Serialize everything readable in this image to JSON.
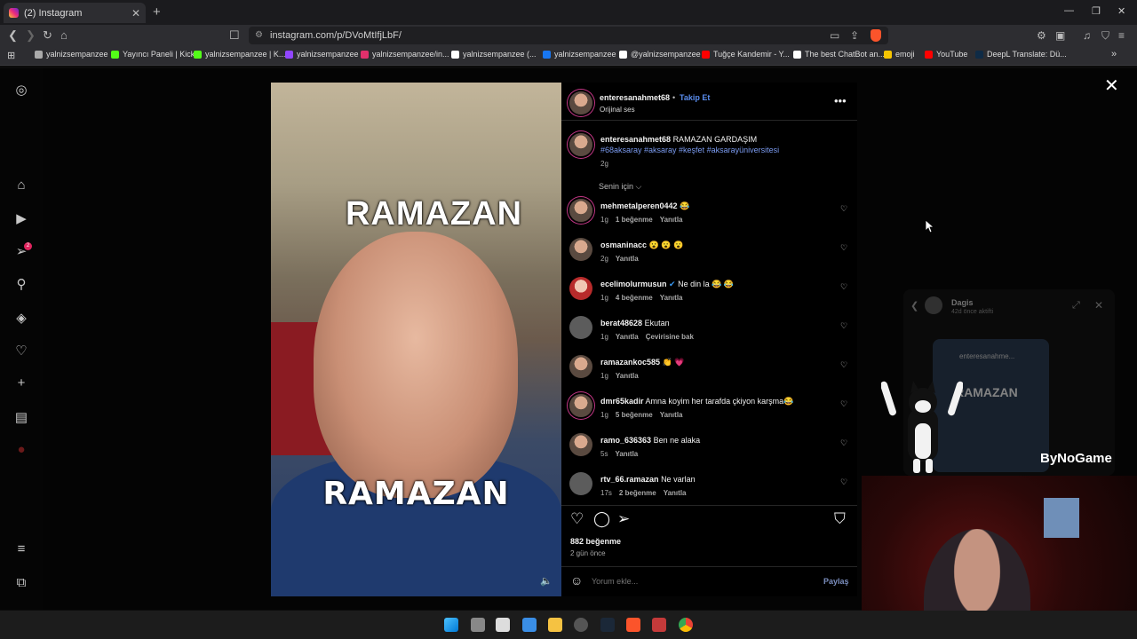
{
  "browser": {
    "tab_title": "(2) Instagram",
    "url": "instagram.com/p/DVoMtIfjLbF/",
    "bookmarks": [
      {
        "label": "yalnizsempanzee",
        "color": "#aaaaaa"
      },
      {
        "label": "Yayıncı Paneli | Kick",
        "color": "#53fc18"
      },
      {
        "label": "yalnizsempanzee | K...",
        "color": "#53fc18"
      },
      {
        "label": "yalnizsempanzee",
        "color": "#9146ff"
      },
      {
        "label": "yalnizsempanzee/in...",
        "color": "#e1306c"
      },
      {
        "label": "yalnizsempanzee (...",
        "color": "#ffffff"
      },
      {
        "label": "yalnizsempanzee",
        "color": "#1877f2"
      },
      {
        "label": "@yalnizsempanzee",
        "color": "#ffffff"
      },
      {
        "label": "Tuğçe Kandemir - Y...",
        "color": "#ff0000"
      },
      {
        "label": "The best ChatBot an...",
        "color": "#ffffff"
      },
      {
        "label": "emoji",
        "color": "#f5c400"
      },
      {
        "label": "YouTube",
        "color": "#ff0000"
      },
      {
        "label": "DeepL Translate: Dü...",
        "color": "#0f2b46"
      }
    ]
  },
  "sidebar": {
    "notification_count": "2"
  },
  "video": {
    "top_text": "RAMAZAN",
    "bottom_text": "RAMAZAN"
  },
  "post": {
    "author": "enteresanahmet68",
    "follow_label": "Takip Et",
    "audio": "Orijinal ses",
    "caption_author": "enteresanahmet68",
    "caption_text": "RAMAZAN GARDAŞIM",
    "hashtags": "#68aksaray #aksaray #keşfet #aksarayüniversitesi",
    "caption_time": "2g",
    "sort_label": "Senin için",
    "comments": [
      {
        "user": "mehmetalperen0442",
        "text": "😂",
        "time": "1g",
        "likes": "1 beğenme",
        "reply": "Yanıtla",
        "extra": ""
      },
      {
        "user": "osmaninacc",
        "text": "😮 😮 😮",
        "time": "2g",
        "likes": "",
        "reply": "Yanıtla",
        "extra": ""
      },
      {
        "user": "ecelimolurmusun",
        "text": "Ne din la 😂 😂",
        "time": "1g",
        "likes": "4 beğenme",
        "reply": "Yanıtla",
        "extra": ""
      },
      {
        "user": "berat48628",
        "text": "Ekutan",
        "time": "1g",
        "likes": "",
        "reply": "Yanıtla",
        "extra": "Çevirisine bak"
      },
      {
        "user": "ramazankoc585",
        "text": "👏 💗",
        "time": "1g",
        "likes": "",
        "reply": "Yanıtla",
        "extra": ""
      },
      {
        "user": "dmr65kadir",
        "text": "Amna koyim her tarafda çkiyon karşma😂",
        "time": "1g",
        "likes": "5 beğenme",
        "reply": "Yanıtla",
        "extra": ""
      },
      {
        "user": "ramo_636363",
        "text": "Ben ne alaka",
        "time": "5s",
        "likes": "",
        "reply": "Yanıtla",
        "extra": ""
      },
      {
        "user": "rtv_66.ramazan",
        "text": "Ne varlan",
        "time": "17s",
        "likes": "2 beğenme",
        "reply": "Yanıtla",
        "extra": ""
      }
    ],
    "likes_count": "882 beğenme",
    "posted": "2 gün önce",
    "comment_placeholder": "Yorum ekle...",
    "share_label": "Paylaş"
  },
  "mini_player": {
    "name": "Dagis",
    "status": "42d önce aktifti",
    "preview_user": "enteresanahme...",
    "preview_text": "RAMAZAN"
  },
  "stream": {
    "watermark": "ByNoGame"
  }
}
